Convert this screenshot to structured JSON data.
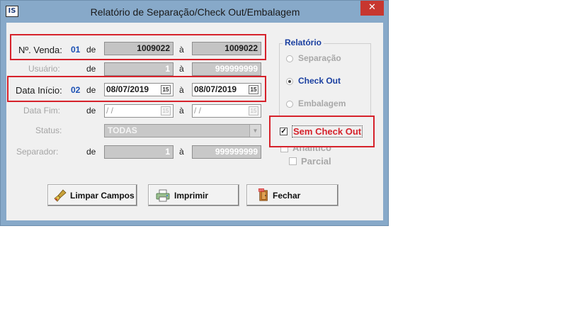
{
  "window": {
    "title": "Relatório de Separação/Check Out/Embalagem",
    "app_icon_text": "IS",
    "close_glyph": "✕"
  },
  "rows": {
    "venda": {
      "label": "Nº. Venda:",
      "num": "01",
      "de": "de",
      "from": "1009022",
      "a": "à",
      "to": "1009022"
    },
    "usuario": {
      "label": "Usuário:",
      "de": "de",
      "from": "1",
      "a": "à",
      "to": "999999999"
    },
    "data_inicio": {
      "label": "Data Início:",
      "num": "02",
      "de": "de",
      "from": "08/07/2019",
      "a": "à",
      "to": "08/07/2019"
    },
    "data_fim": {
      "label": "Data Fim:",
      "de": "de",
      "from": " / /",
      "a": "à",
      "to": " / /"
    },
    "status": {
      "label": "Status:",
      "value": "TODAS"
    },
    "separador": {
      "label": "Separador:",
      "de": "de",
      "from": "1",
      "a": "à",
      "to": "999999999"
    }
  },
  "calendar_icon_text": "15",
  "relatorio": {
    "title": "Relatório",
    "options": [
      {
        "label": "Separação",
        "selected": false,
        "enabled": false
      },
      {
        "label": "Check Out",
        "selected": true,
        "enabled": true
      },
      {
        "label": "Embalagem",
        "selected": false,
        "enabled": false
      }
    ]
  },
  "checks": {
    "sem_check_out": {
      "label": "Sem Check Out",
      "checked": true
    },
    "analitico": {
      "label": "Analítico",
      "checked": false
    },
    "parcial": {
      "label": "Parcial",
      "checked": false
    }
  },
  "buttons": {
    "limpar": "Limpar Campos",
    "imprimir": "Imprimir",
    "fechar": "Fechar"
  },
  "colors": {
    "highlight": "#d6222b",
    "accent": "#1a4fb4",
    "title_bar": "#87a9c9"
  },
  "icons": {
    "broom": "broom-icon",
    "printer": "printer-icon",
    "exit": "exit-door-icon",
    "calendar": "calendar-icon"
  }
}
